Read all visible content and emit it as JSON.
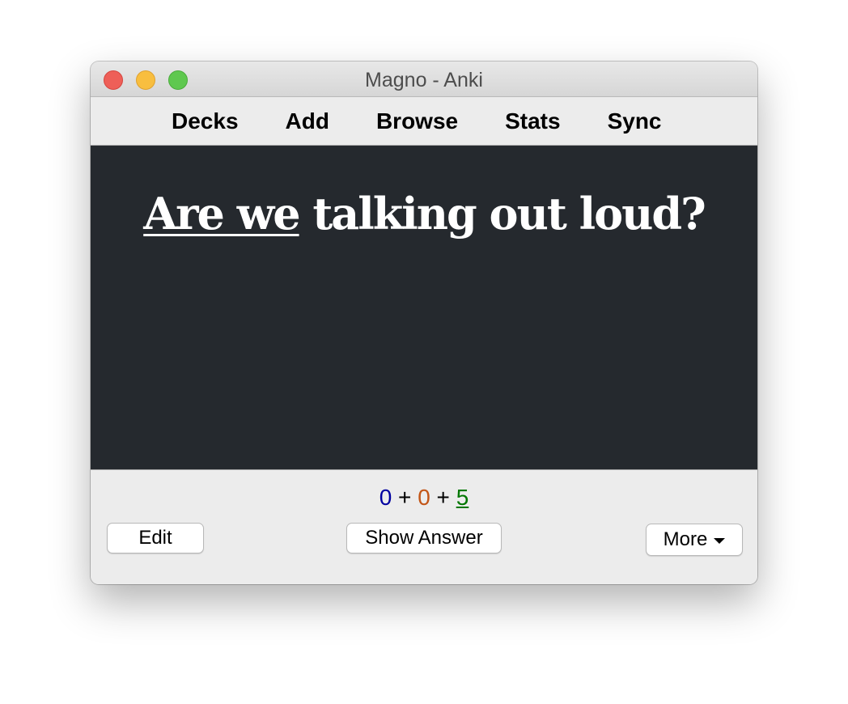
{
  "window": {
    "title": "Magno - Anki"
  },
  "toolbar": {
    "items": [
      {
        "label": "Decks"
      },
      {
        "label": "Add"
      },
      {
        "label": "Browse"
      },
      {
        "label": "Stats"
      },
      {
        "label": "Sync"
      }
    ]
  },
  "card": {
    "question_highlight": "Are we",
    "question_rest": " talking out loud?",
    "background_color": "#25292e"
  },
  "counts": {
    "new": "0",
    "sep1": " + ",
    "learn": "0",
    "sep2": " + ",
    "review": "5",
    "colors": {
      "new": "#0000a0",
      "learn": "#c35617",
      "review": "#007700"
    }
  },
  "buttons": {
    "edit": "Edit",
    "show_answer": "Show Answer",
    "more": "More"
  }
}
